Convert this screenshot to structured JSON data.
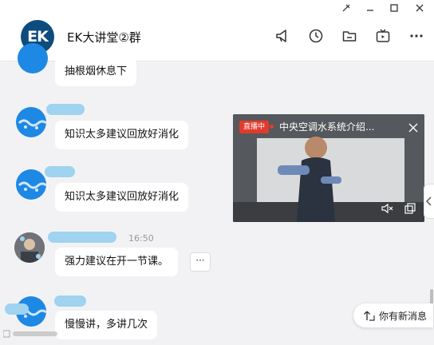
{
  "header": {
    "logo_text": "EK",
    "group_name": "EK大讲堂②群"
  },
  "window_controls": [
    "pin-icon",
    "minimize-icon",
    "maximize-icon",
    "close-icon"
  ],
  "toolbar_icons": [
    "announcement-icon",
    "history-icon",
    "folder-icon",
    "live-icon",
    "more-icon"
  ],
  "messages": [
    {
      "text": "抽根烟休息下"
    },
    {
      "text": "知识太多建议回放好消化"
    },
    {
      "text": "知识太多建议回放好消化"
    },
    {
      "text": "强力建议在开一节课。",
      "time": "16:50"
    },
    {
      "text": "慢慢讲，多讲几次"
    }
  ],
  "live_window": {
    "badge": "直播中",
    "title": "中央空调水系统介绍..."
  },
  "new_message_tip": "你有新消息",
  "colors": {
    "accent_blue": "#1e88e5",
    "live_red": "#e23b2e",
    "logo_navy": "#0e4c7e"
  }
}
